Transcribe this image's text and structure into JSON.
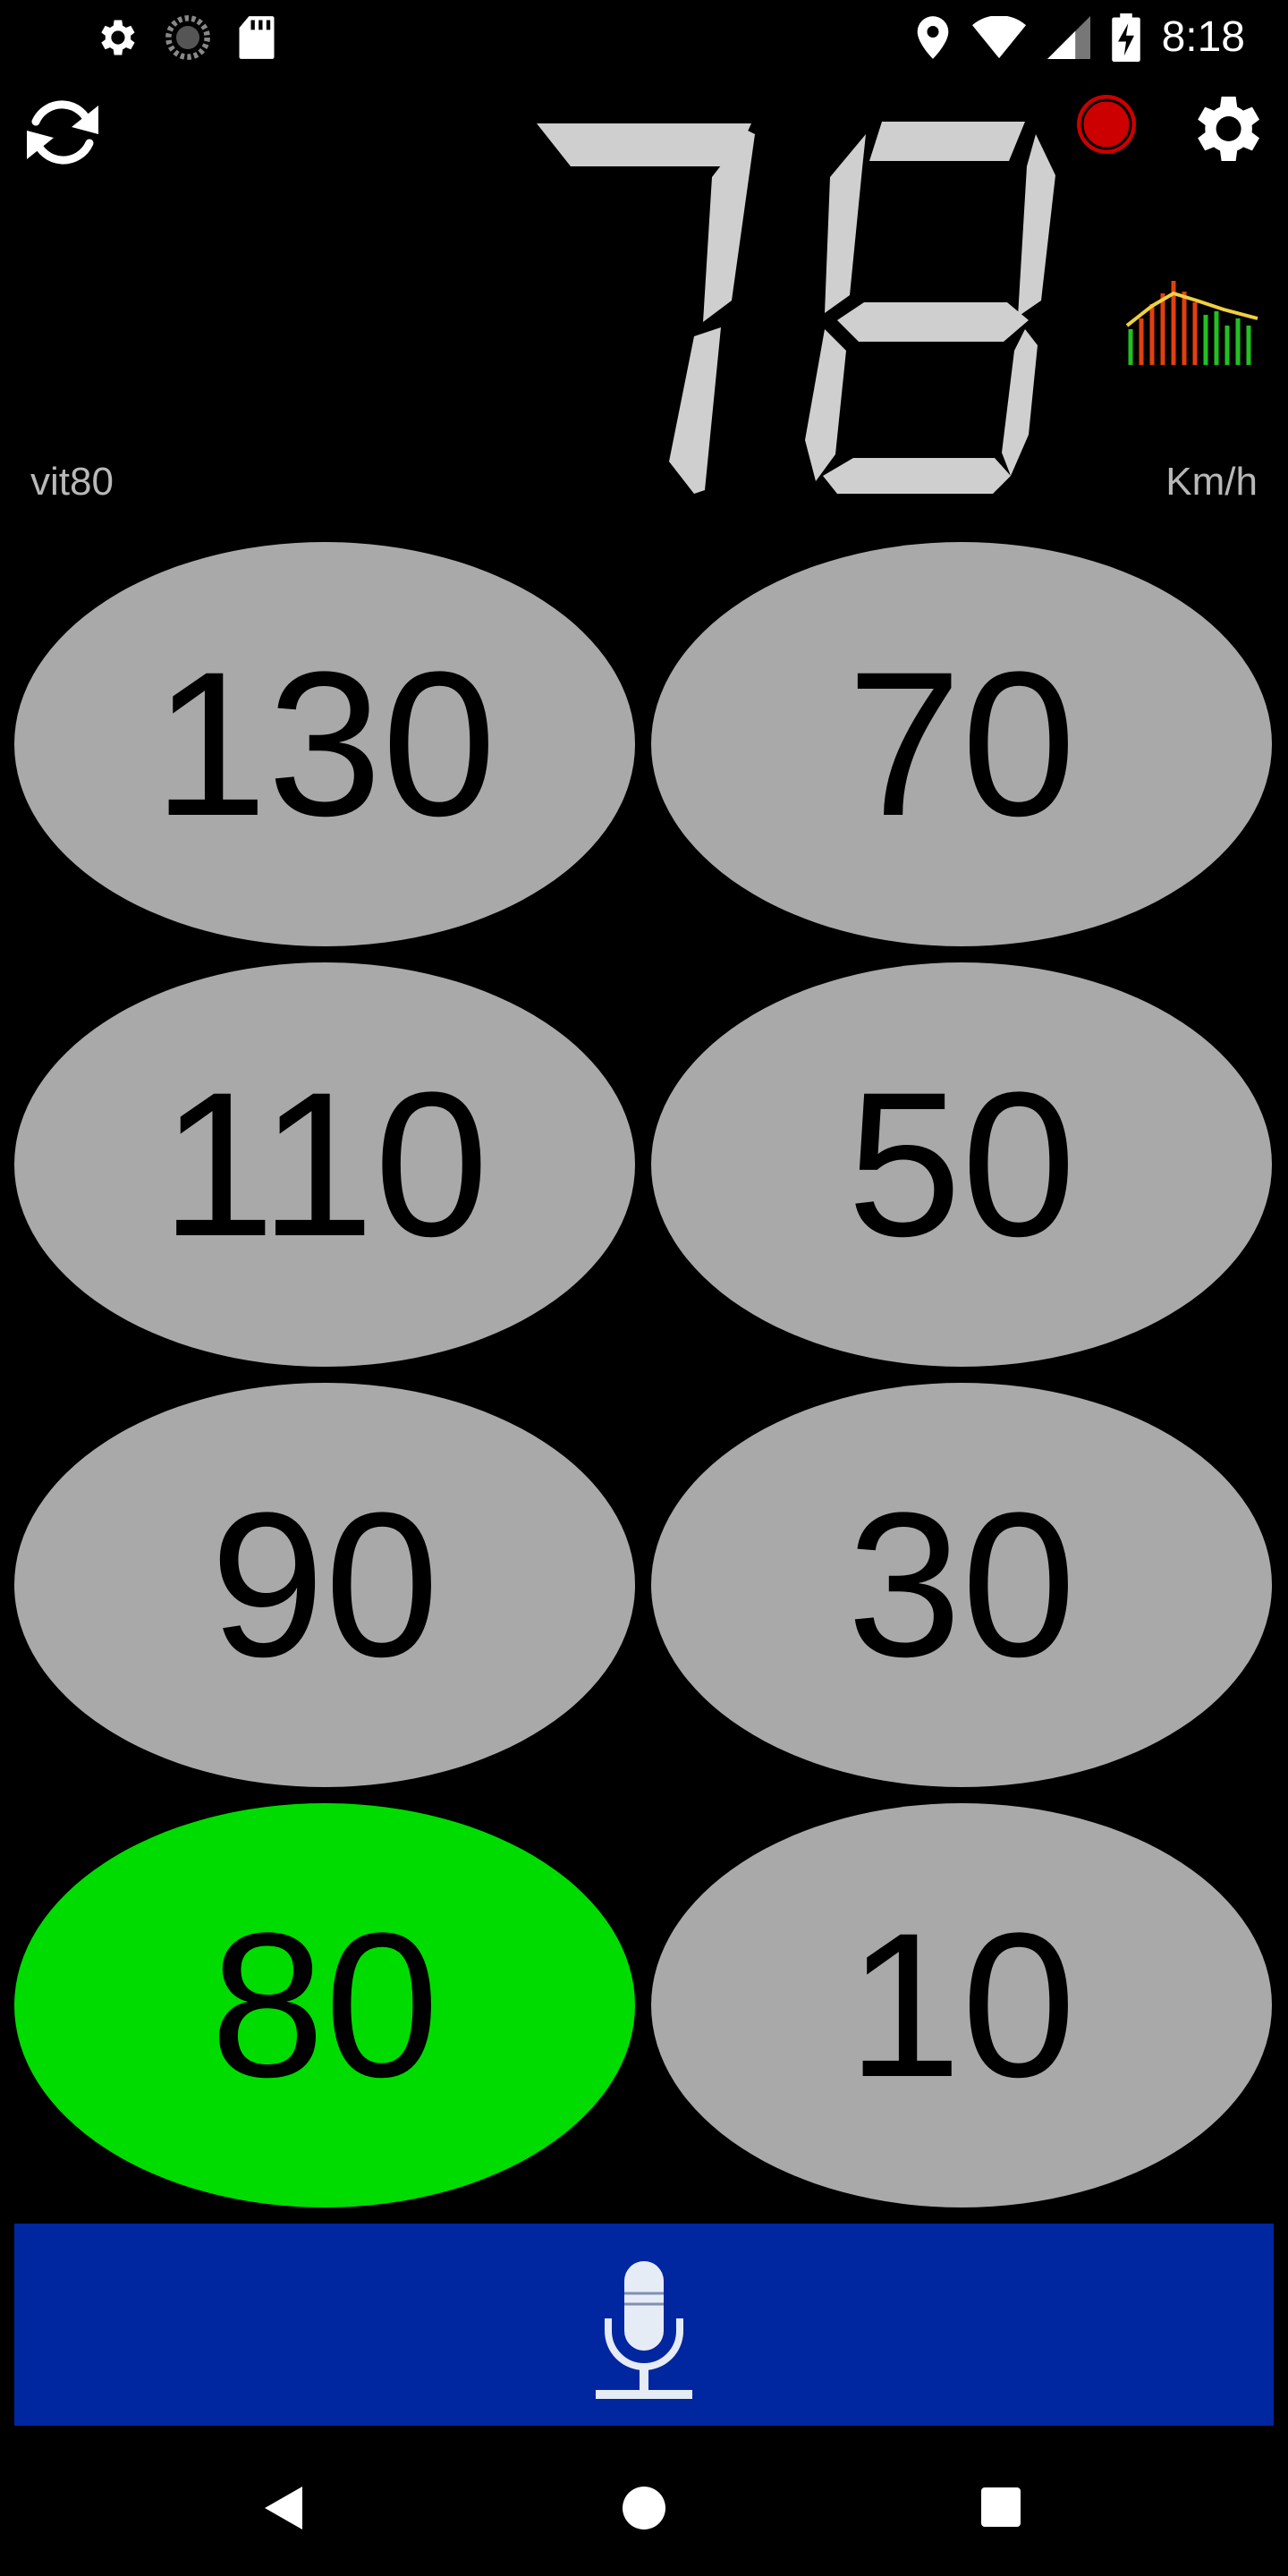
{
  "status_bar": {
    "time": "8:18",
    "icons_left": [
      "settings-gear-icon",
      "sync-spinner-icon",
      "sd-card-icon"
    ],
    "icons_right": [
      "location-pin-icon",
      "wifi-icon",
      "signal-icon",
      "battery-charging-icon"
    ]
  },
  "header": {
    "refresh_icon": "refresh-icon",
    "record_icon": "record-icon",
    "settings_icon": "settings-gear-icon",
    "graph_icon": "speed-graph-icon"
  },
  "speed": {
    "value": "78",
    "unit": "Km/h",
    "limit_label": "vit80"
  },
  "limits": [
    {
      "label": "130",
      "active": false
    },
    {
      "label": "70",
      "active": false
    },
    {
      "label": "110",
      "active": false
    },
    {
      "label": "50",
      "active": false
    },
    {
      "label": "90",
      "active": false
    },
    {
      "label": "30",
      "active": false
    },
    {
      "label": "80",
      "active": true
    },
    {
      "label": "10",
      "active": false
    }
  ],
  "mic": {
    "icon": "microphone-icon"
  },
  "nav": {
    "back": "back-icon",
    "home": "home-icon",
    "recent": "recent-apps-icon"
  },
  "colors": {
    "background": "#000000",
    "button_gray": "#a9a9a9",
    "button_active": "#00dc00",
    "mic_bar": "#0026a0",
    "digit_color": "#cfcfcf",
    "record_red": "#cc0000"
  }
}
